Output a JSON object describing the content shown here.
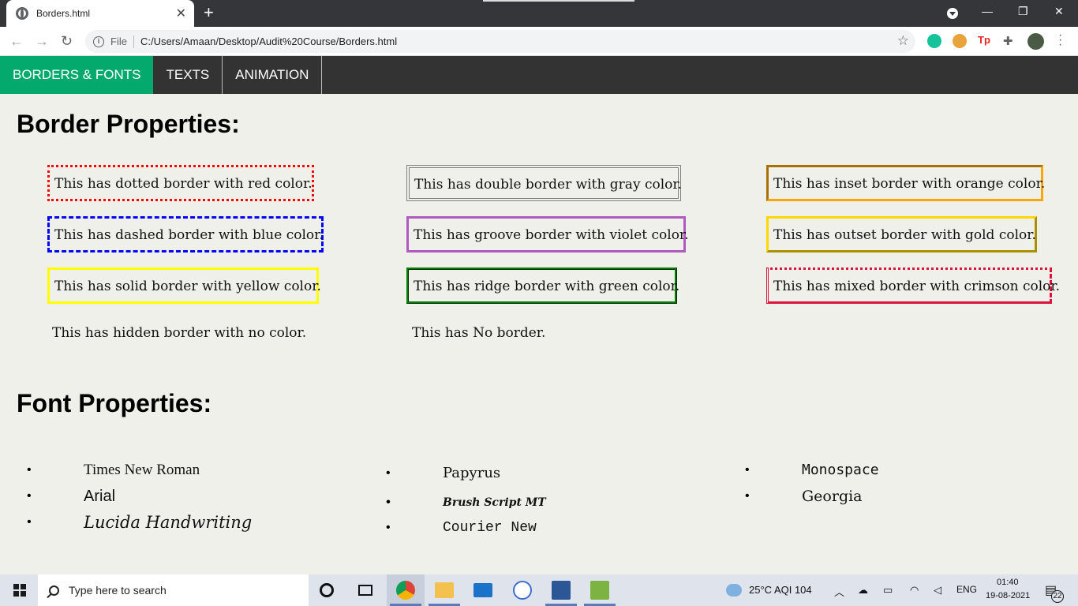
{
  "browser": {
    "tab_title": "Borders.html",
    "tab_close": "✕",
    "new_tab": "+",
    "address_prefix": "File",
    "address_url": "C:/Users/Amaan/Desktop/Audit%20Course/Borders.html",
    "back": "←",
    "forward": "→",
    "reload": "↻",
    "star": "☆",
    "minimize": "—",
    "restore": "❐",
    "close": "✕",
    "extensions": [
      "grammarly-icon",
      "honey-icon",
      "tp-icon",
      "puzzle-icon",
      "profile-avatar"
    ]
  },
  "navbar": {
    "items": [
      "BORDERS & FONTS",
      "TEXTS",
      "ANIMATION"
    ],
    "active_color": "#04aa6d"
  },
  "page": {
    "border_heading": "Border Properties:",
    "borders": [
      "This has dotted border with red color.",
      "This has dashed border with blue color.",
      "This has solid border with yellow color.",
      "This has hidden border with no color.",
      "This has double border with gray color.",
      "This has groove border with violet color.",
      "This has ridge border with green color.",
      "This has No border.",
      "This has inset border with orange color.",
      "This has outset border with gold color.",
      "This has mixed border with crimson color."
    ],
    "font_heading": "Font Properties:",
    "fonts_col1": [
      "Times New Roman",
      "Arial",
      "Lucida Handwriting"
    ],
    "fonts_col2": [
      "Papyrus",
      "Brush Script MT",
      "Courier New"
    ],
    "fonts_col3": [
      "Monospace",
      "Georgia"
    ]
  },
  "taskbar": {
    "search_placeholder": "Type here to search",
    "weather": "25°C  AQI 104",
    "lang": "ENG",
    "time": "01:40",
    "date": "19-08-2021",
    "notifications": "22"
  }
}
